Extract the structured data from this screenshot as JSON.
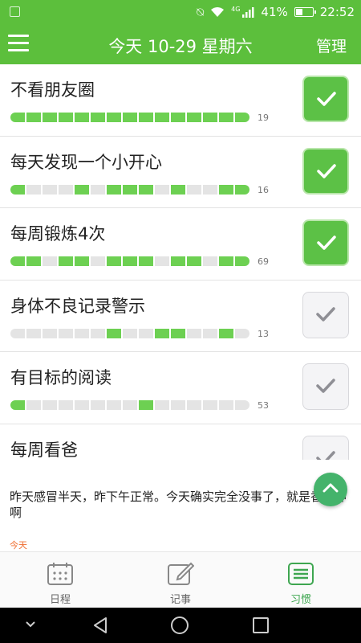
{
  "status_bar": {
    "network_type": "4G",
    "battery": "41%",
    "battery_level": 0.41,
    "time": "22:52"
  },
  "header": {
    "title": "今天 10-29 星期六",
    "manage_label": "管理",
    "menu_icon": "hamburger-menu-icon"
  },
  "habits": [
    {
      "name": "不看朋友圈",
      "count": "19",
      "checked": true,
      "days": [
        1,
        1,
        1,
        1,
        1,
        1,
        1,
        1,
        1,
        1,
        1,
        1,
        1,
        1,
        1
      ]
    },
    {
      "name": "每天发现一个小开心",
      "count": "16",
      "checked": true,
      "days": [
        1,
        0,
        0,
        0,
        1,
        0,
        1,
        1,
        1,
        0,
        1,
        0,
        0,
        1,
        1
      ]
    },
    {
      "name": "每周锻炼4次",
      "count": "69",
      "checked": true,
      "days": [
        1,
        1,
        0,
        1,
        1,
        0,
        1,
        1,
        1,
        0,
        1,
        1,
        0,
        1,
        1
      ]
    },
    {
      "name": "身体不良记录警示",
      "count": "13",
      "checked": false,
      "days": [
        0,
        0,
        0,
        0,
        0,
        0,
        1,
        0,
        0,
        1,
        1,
        0,
        0,
        1,
        0
      ]
    },
    {
      "name": "有目标的阅读",
      "count": "53",
      "checked": false,
      "days": [
        1,
        0,
        0,
        0,
        0,
        0,
        0,
        0,
        1,
        0,
        0,
        0,
        0,
        0,
        0
      ]
    },
    {
      "name": "每周看爸",
      "count": "",
      "checked": false,
      "days": [
        0,
        0,
        0,
        0,
        0,
        0,
        0,
        0,
        0,
        0,
        0,
        0,
        0,
        0,
        0
      ]
    }
  ],
  "note": {
    "text": "昨天感冒半天，昨下午正常。今天确实完全没事了，就是香大神啊",
    "date_label": "今天"
  },
  "bottom_nav": [
    {
      "label": "日程",
      "icon": "calendar-icon",
      "active": false
    },
    {
      "label": "记事",
      "icon": "edit-note-icon",
      "active": false
    },
    {
      "label": "习惯",
      "icon": "list-icon",
      "active": true
    }
  ],
  "colors": {
    "primary_green": "#5cbf3c",
    "progress_on": "#6dd052",
    "progress_off": "#e4e4e4",
    "date_orange": "#ef6c2e"
  }
}
